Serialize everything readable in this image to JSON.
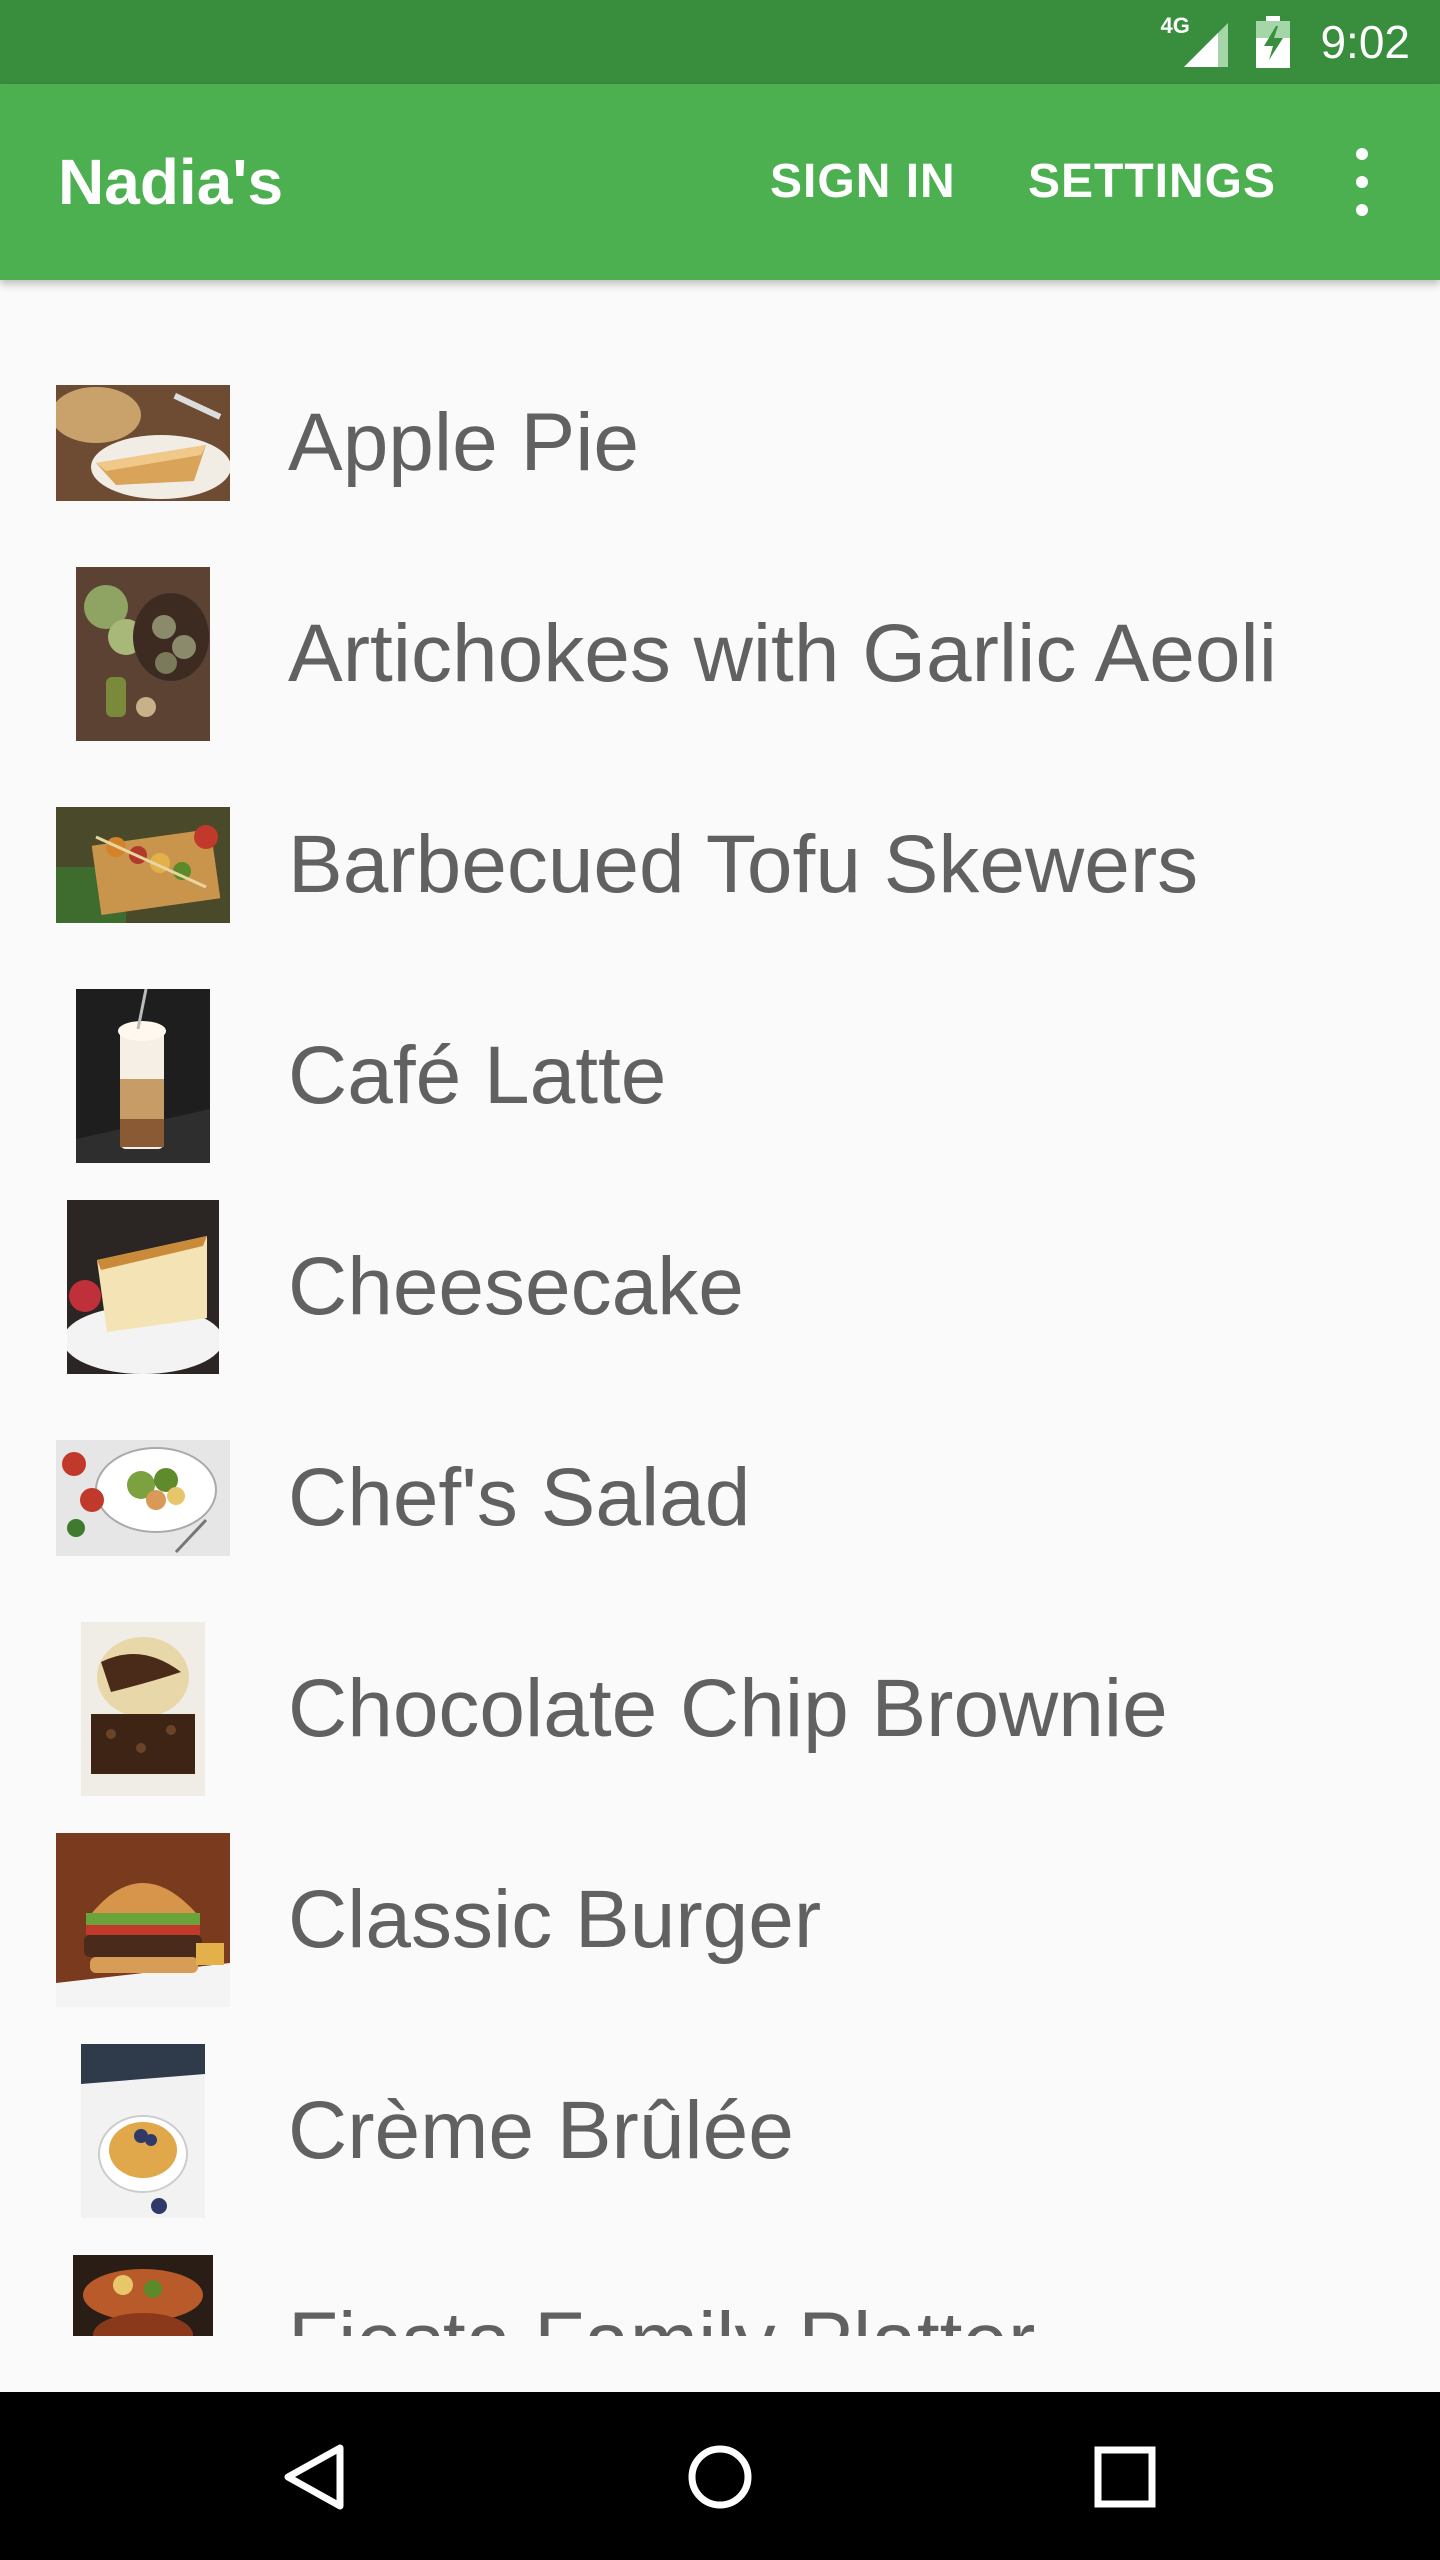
{
  "status_bar": {
    "network_label": "4G",
    "time": "9:02",
    "icons": [
      "signal-icon",
      "battery-icon"
    ]
  },
  "app_bar": {
    "title": "Nadia's",
    "actions": {
      "sign_in": "SIGN IN",
      "settings": "SETTINGS"
    },
    "overflow_icon": "more-vert-icon"
  },
  "menu_items": [
    {
      "name": "Apple Pie",
      "thumb": "apple-pie-photo"
    },
    {
      "name": "Artichokes with Garlic Aeoli",
      "thumb": "artichokes-photo"
    },
    {
      "name": "Barbecued Tofu Skewers",
      "thumb": "tofu-skewers-photo"
    },
    {
      "name": "Café Latte",
      "thumb": "cafe-latte-photo"
    },
    {
      "name": "Cheesecake",
      "thumb": "cheesecake-photo"
    },
    {
      "name": "Chef's Salad",
      "thumb": "chefs-salad-photo"
    },
    {
      "name": "Chocolate Chip Brownie",
      "thumb": "brownie-photo"
    },
    {
      "name": "Classic Burger",
      "thumb": "burger-photo"
    },
    {
      "name": "Crème Brûlée",
      "thumb": "creme-brulee-photo"
    },
    {
      "name": "Fiesta Family Platter",
      "thumb": "fiesta-platter-photo"
    }
  ],
  "nav_bar": {
    "icons": [
      "back-icon",
      "home-icon",
      "recents-icon"
    ]
  },
  "colors": {
    "status_bar": "#388e3c",
    "app_bar": "#4caf50",
    "background": "#fafafa",
    "item_text": "#616161",
    "nav_bar": "#000000"
  }
}
